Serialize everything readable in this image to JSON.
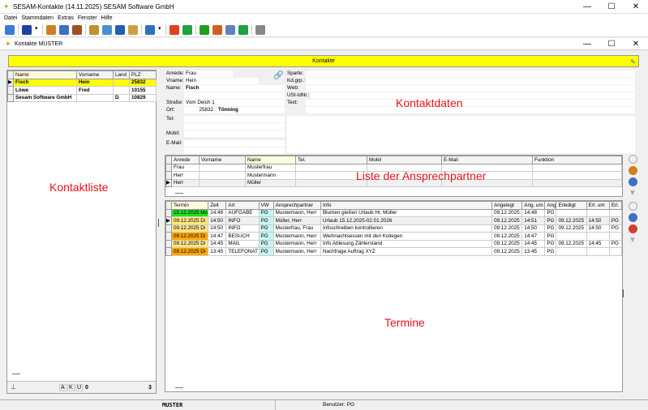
{
  "window": {
    "title": "SESAM-Kontakte (14.11.2025) SESAM Software GmbH",
    "minimize": "—",
    "maximize": "☐",
    "close": "✕"
  },
  "menu": [
    "Datei",
    "Stammdaten",
    "Extras",
    "Fenster",
    "Hilfe"
  ],
  "toolbar_icons": [
    "exit-icon",
    "save-icon",
    "save-dropdown-icon",
    "stamp-icon",
    "calendar-icon",
    "contacts-icon",
    "search-icon",
    "search-window-icon",
    "phone-book-icon",
    "folder-search-icon",
    "screen-icon",
    "screen-dropdown-icon",
    "alarm-icon",
    "excel-icon",
    "checkmark-icon",
    "handshake-icon",
    "stopwatch-icon",
    "up-arrow-icon",
    "cancel-icon"
  ],
  "child": {
    "title": "Kontakte MUSTER",
    "minimize": "—",
    "maximize": "☐",
    "close": "✕"
  },
  "banner": {
    "title": "Kontakte"
  },
  "contact_list": {
    "columns": [
      "Name",
      "Vorname",
      "Land",
      "PLZ"
    ],
    "rows": [
      [
        "Fisch",
        "Hein",
        "",
        "25832"
      ],
      [
        "Löwe",
        "Fred",
        "",
        "10155"
      ],
      [
        "Sesam Software GmbH",
        "",
        "D",
        "10829"
      ]
    ],
    "selected": 0,
    "overlay_label": "Kontaktliste",
    "footer": {
      "filters": [
        "A",
        "K",
        "U"
      ],
      "count_left": "0",
      "count_right": "3"
    }
  },
  "contact": {
    "anrede_label": "Anrede:",
    "anrede": "Frau",
    "vname_label": "Vname:",
    "vname": "Hein",
    "name_label": "Name:",
    "name": "Fisch",
    "strasse_label": "Straße:",
    "strasse": "Vom Deich 1",
    "ort_label": "Ort:",
    "plz": "25832",
    "ort": "Tönning",
    "tel_label": "Tel:",
    "mobil_label": "Mobil:",
    "email_label": "E-Mail:",
    "sparte_label": "Sparte:",
    "kdgrp_label": "Kd.grp.:",
    "web_label": "Web:",
    "ustid_label": "USt-IdNr.:",
    "text_label": "Text:",
    "overlay_label": "Kontaktdaten"
  },
  "ansprechpartner": {
    "columns": [
      "Anrede",
      "Vorname",
      "Name",
      "Tel.",
      "Mobil",
      "E-Mail",
      "Funktion"
    ],
    "rows": [
      [
        "Frau",
        "",
        "Musterfrau",
        "",
        "",
        "",
        ""
      ],
      [
        "Herr",
        "",
        "Mustermann",
        "",
        "",
        "",
        ""
      ],
      [
        "Herr",
        "",
        "Müller",
        "",
        "",
        "",
        ""
      ]
    ],
    "selected": 2,
    "overlay_label": "Liste der Ansprechpartner"
  },
  "termine": {
    "columns": [
      "Termin",
      "Zeit",
      "Art",
      "VW",
      "Ansprechpartner",
      "Info",
      "Angelegt",
      "Ang. um",
      "Ang.",
      "Erledigt",
      "Erl. um",
      "Erl."
    ],
    "rows": [
      {
        "termin": "15.12.2025  Mo",
        "color": "#22dd22",
        "zeit": "14:48",
        "art": "AUFGABE",
        "vw": "PG",
        "ap": "Mustermann, Herr",
        "info": "Blumen gießen Urlaub Hr. Müller",
        "angelegt": "09.12.2025",
        "angum": "14:48",
        "ang": "PG",
        "erledigt": "",
        "erlum": "",
        "erl": ""
      },
      {
        "termin": "09.12.2025  Di",
        "color": "#ffe680",
        "zeit": "14:50",
        "art": "INFO",
        "vw": "PG",
        "ap": "Müller, Herr",
        "info": "Urlaub 15.12.2025-02.01.2026",
        "angelegt": "09.12.2025",
        "angum": "14:51",
        "ang": "PG",
        "erledigt": "09.12.2025",
        "erlum": "14:50",
        "erl": "PG"
      },
      {
        "termin": "09.12.2025  Di",
        "color": "#ffe680",
        "zeit": "14:50",
        "art": "INFO",
        "vw": "PG",
        "ap": "Musterfrau, Frau",
        "info": "Infoschreiben kontrollieren",
        "angelegt": "09.12.2025",
        "angum": "14:50",
        "ang": "PG",
        "erledigt": "09.12.2025",
        "erlum": "14:50",
        "erl": "PG"
      },
      {
        "termin": "09.12.2025  Di",
        "color": "#ffa500",
        "zeit": "14:47",
        "art": "BESUCH",
        "vw": "PG",
        "ap": "Mustermann, Herr",
        "info": "Weihnachtsessen mit den Kollegen",
        "angelegt": "09.12.2025",
        "angum": "14:47",
        "ang": "PG",
        "erledigt": "",
        "erlum": "",
        "erl": ""
      },
      {
        "termin": "09.12.2025  Di",
        "color": "#ffe680",
        "zeit": "14:45",
        "art": "MAIL",
        "vw": "PG",
        "ap": "Mustermann, Herr",
        "info": "Info Ablesung Zählerstand",
        "angelegt": "09.12.2025",
        "angum": "14:45",
        "ang": "PG",
        "erledigt": "09.12.2025",
        "erlum": "14:45",
        "erl": "PG"
      },
      {
        "termin": "09.12.2025  Di",
        "color": "#ffa500",
        "zeit": "13:45",
        "art": "TELEFONAT",
        "vw": "PG",
        "ap": "Mustermann, Herr",
        "info": "Nachfrage Auftrag XYZ",
        "angelegt": "09.12.2025",
        "angum": "13:45",
        "ang": "PG",
        "erledigt": "",
        "erlum": "",
        "erl": ""
      }
    ],
    "selected": 1,
    "overlay_label": "Termine"
  },
  "statusbar": {
    "company": "MUSTER",
    "user": "Benutzer: PG"
  }
}
